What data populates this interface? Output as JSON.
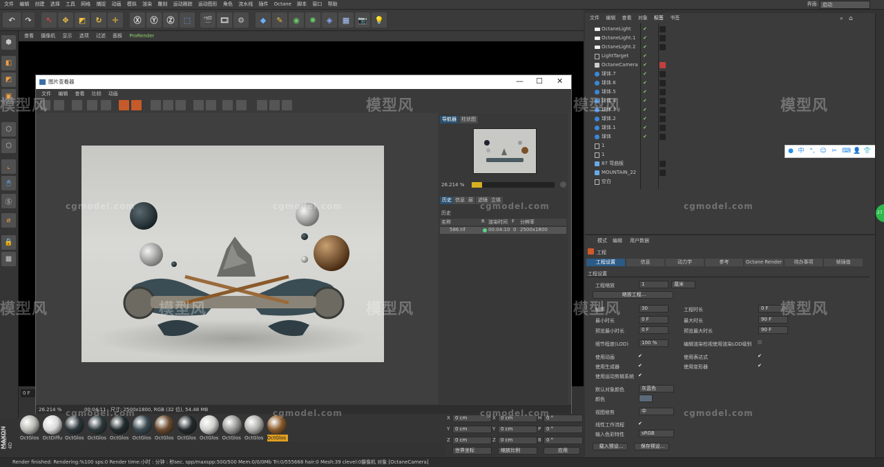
{
  "menubar": {
    "items": [
      "文件",
      "编辑",
      "创建",
      "选择",
      "工具",
      "网格",
      "捕捉",
      "动画",
      "模拟",
      "渲染",
      "雕刻",
      "运动跟踪",
      "运动图形",
      "角色",
      "流水线",
      "插件",
      "Octane",
      "脚本",
      "窗口",
      "帮助"
    ],
    "layout_label": "界面:",
    "layout_value": "启动"
  },
  "viewport": {
    "menu": [
      "查看",
      "摄像机",
      "显示",
      "选项",
      "过滤",
      "面板",
      "ProRender"
    ],
    "frame_field": "0 F"
  },
  "picture_viewer": {
    "title": "图片查看器",
    "menu": [
      "文件",
      "编辑",
      "查看",
      "比较",
      "动画"
    ],
    "nav_tabs": [
      "导航器",
      "柱状图"
    ],
    "zoom": "26.214 %",
    "history_tabs": [
      "历史",
      "信息",
      "层",
      "滤镜",
      "立体"
    ],
    "history_header": "历史",
    "columns": [
      "名称",
      "R",
      "渲染时间",
      "F",
      "分辨率"
    ],
    "row": {
      "name": "586.tif",
      "time": "00:04:10",
      "frame": "0",
      "resolution": "2500x1800"
    },
    "status_zoom": "26.214 %",
    "status_time": "00:04:11",
    "status_info": "尺寸: 2500x1800, RGB (32 位), 54.48 MB"
  },
  "object_manager": {
    "menu": [
      "文件",
      "编辑",
      "查看",
      "对象",
      "标签",
      "书签"
    ],
    "objects": [
      {
        "name": "OctaneLight",
        "icon": "light"
      },
      {
        "name": "OctaneLight.1",
        "icon": "light"
      },
      {
        "name": "OctaneLight.2",
        "icon": "light"
      },
      {
        "name": "LightTarget",
        "icon": "null"
      },
      {
        "name": "OctaneCamera",
        "icon": "camera"
      },
      {
        "name": "球体.7",
        "icon": "sphere"
      },
      {
        "name": "球体.6",
        "icon": "sphere"
      },
      {
        "name": "球体.5",
        "icon": "sphere"
      },
      {
        "name": "球体.4",
        "icon": "sphere"
      },
      {
        "name": "球体.3",
        "icon": "sphere"
      },
      {
        "name": "球体.2",
        "icon": "sphere"
      },
      {
        "name": "球体.1",
        "icon": "sphere"
      },
      {
        "name": "球体",
        "icon": "sphere"
      },
      {
        "name": "1",
        "icon": "null"
      },
      {
        "name": "1",
        "icon": "null"
      },
      {
        "name": "87 弯曲板",
        "icon": "mesh"
      },
      {
        "name": "MOUNTAIN_22",
        "icon": "mesh"
      },
      {
        "name": "空白",
        "icon": "null"
      }
    ]
  },
  "attributes": {
    "menu": [
      "模式",
      "编辑",
      "用户数据"
    ],
    "object_name": "工程",
    "tabs": [
      "工程设置",
      "信息",
      "动力学",
      "参考",
      "Octane Render",
      "待办事项",
      "帧插值"
    ],
    "section": "工程设置",
    "scale_label": "工程缩放",
    "scale_value": "1",
    "scale_unit": "厘米",
    "scale_button": "缩放工程...",
    "fps_label": "帧率",
    "fps_value": "30",
    "project_time_label": "工程时长",
    "project_time_value": "0 F",
    "min_time_label": "最小时长",
    "min_time_value": "0 F",
    "max_time_label": "最大时长",
    "max_time_value": "90 F",
    "preview_min_label": "预览最小时长",
    "preview_min_value": "0 F",
    "preview_max_label": "预览最大时长",
    "preview_max_value": "90 F",
    "lod_label": "细节程度(LOD)",
    "lod_value": "100 %",
    "render_lod_label": "编辑渲染检视使用渲染LOD级别",
    "use_anim_label": "使用动画",
    "use_expr_label": "使用表达式",
    "use_gen_label": "使用生成器",
    "use_deform_label": "使用变形器",
    "use_motion_label": "使用运动剪辑系统",
    "default_color_label": "默认对象颜色",
    "default_color_value": "灰蓝色",
    "color_label": "颜色",
    "view_clip_label": "视图修剪",
    "view_clip_value": "中",
    "linear_label": "线性工作流程",
    "input_color_label": "输入色彩特性",
    "input_color_value": "sRGB",
    "load_button": "载入预设...",
    "save_button": "保存预设..."
  },
  "materials": [
    {
      "label": "OctGlos",
      "color": "#b8b8b4"
    },
    {
      "label": "OctDiffu",
      "color": "#d8d8d8"
    },
    {
      "label": "OctGlos",
      "color": "#2a3438"
    },
    {
      "label": "OctGlos",
      "color": "#2d383c"
    },
    {
      "label": "OctGlos",
      "color": "#222b2e"
    },
    {
      "label": "OctGlos",
      "color": "#3a4a52"
    },
    {
      "label": "OctGlos",
      "color": "#6a4a2e"
    },
    {
      "label": "OctGlos",
      "color": "#232a2c"
    },
    {
      "label": "OctGlos",
      "color": "#cfcfcc"
    },
    {
      "label": "OctGlos",
      "color": "#9a9a98"
    },
    {
      "label": "OctGlos",
      "color": "#b0b0ad"
    },
    {
      "label": "OctGlos",
      "color": "#8a5a2a"
    }
  ],
  "coords": {
    "x1": "0 cm",
    "y1": "0 cm",
    "z1": "0 cm",
    "x2": "0 cm",
    "y2": "0 cm",
    "z2": "0 cm",
    "h": "0 °",
    "p": "0 °",
    "b": "0 °",
    "world": "世界坐标",
    "size": "缩放比例",
    "apply": "应用"
  },
  "statusbar": {
    "render": "Render finished: Rendering:%100 sps:0 Render time:小时 : 分钟 : 秒sec. spp/maxspp:500/500 Mem:0/0/0Mb Tri:0/555668 hair:0 Mesh:39 clevel:0",
    "camera": "摄像机 对象 [OctaneCamera]"
  },
  "branding": {
    "maxon": "MAXON",
    "c4d": "CINEMA 4D"
  },
  "watermarks": {
    "brand": "模型风",
    "url": "cgmodel.com"
  },
  "badge": "27",
  "colors": {
    "accent": "#2c5b86",
    "check": "#8bd26b",
    "green_badge": "#2db84a"
  }
}
